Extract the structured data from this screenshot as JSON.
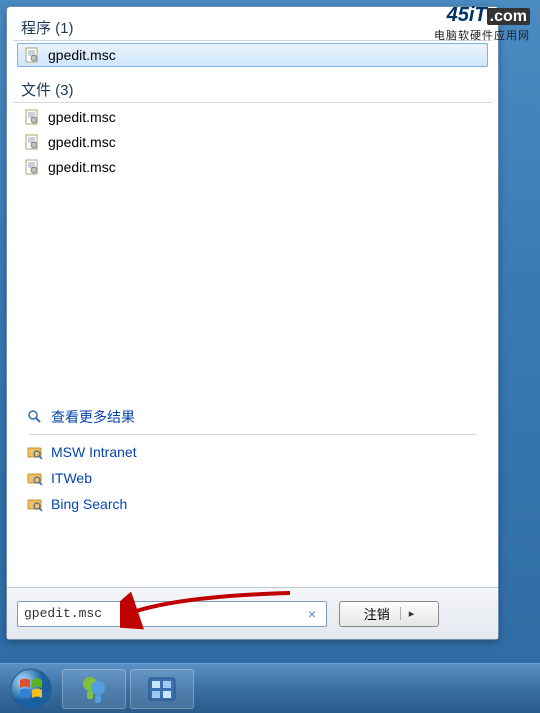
{
  "watermark": {
    "brand": "45iT",
    "suffix": ".com",
    "subtitle": "电脑软硬件应用网"
  },
  "sections": {
    "programs_header": "程序 (1)",
    "files_header": "文件 (3)"
  },
  "programs": [
    {
      "name": "gpedit.msc",
      "selected": true
    }
  ],
  "files": [
    {
      "name": "gpedit.msc"
    },
    {
      "name": "gpedit.msc"
    },
    {
      "name": "gpedit.msc"
    }
  ],
  "links": {
    "more_results": "查看更多结果",
    "items": [
      {
        "name": "MSW Intranet"
      },
      {
        "name": "ITWeb"
      },
      {
        "name": "Bing Search"
      }
    ]
  },
  "search": {
    "value": "gpedit.msc",
    "clear": "×"
  },
  "logout": {
    "label": "注销",
    "arrow": "▸"
  }
}
